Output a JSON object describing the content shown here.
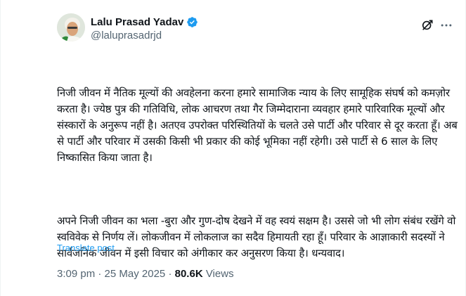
{
  "author": {
    "display_name": "Lalu Prasad Yadav",
    "handle": "@laluprasadrjd",
    "verified_color": "#1d9bf0"
  },
  "icons": {
    "avatar": "profile-photo",
    "verified": "verified-badge-icon",
    "grok": "grok-icon",
    "more": "more-options-icon"
  },
  "tweet": {
    "paragraph_1": "निजी जीवन में नैतिक मूल्यों की अवहेलना करना हमारे सामाजिक न्याय के लिए सामूहिक संघर्ष को कमज़ोर करता है। ज्येष्ठ पुत्र की गतिविधि, लोक आचरण तथा गैर जिम्मेदाराना व्यवहार हमारे पारिवारिक मूल्यों और संस्कारों के अनुरूप नहीं है। अतएव उपरोक्त परिस्थितियों के चलते उसे पार्टी और परिवार से दूर करता हूँ। अब से पार्टी और परिवार में उसकी किसी भी प्रकार की कोई भूमिका नहीं रहेगी। उसे पार्टी से 6 साल के लिए निष्कासित किया जाता है।",
    "paragraph_2": "अपने निजी जीवन का भला -बुरा और गुण-दोष देखने में वह स्वयं सक्षम है। उससे जो भी लोग संबंध रखेंगे वो स्वविवेक से निर्णय लें। लोकजीवन में लोकलाज का सदैव हिमायती रहा हूँ। परिवार के आज्ञाकारी सदस्यों ने सार्वजनिक जीवन में इसी विचार को अंगीकार कर अनुसरण किया है। धन्यवाद।",
    "translate_label": "Translate post"
  },
  "meta": {
    "time": "3:09 pm",
    "separator": "·",
    "date": "25 May 2025",
    "views_count": "80.6K",
    "views_label": "Views"
  }
}
